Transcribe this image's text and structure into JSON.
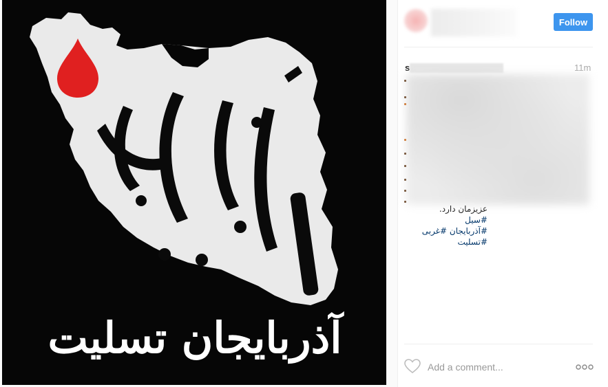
{
  "post": {
    "image": {
      "caption_art_text": "آذربایجان تسلیت",
      "map_label": "آذربایجان",
      "colors": {
        "background": "#060606",
        "map": "#eaeaea",
        "drop": "#e02020"
      }
    },
    "author": {
      "username_visible_initial": "s"
    },
    "follow_label": "Follow",
    "timestamp": "11m",
    "caption": {
      "last_line": "عزیزمان دارد.",
      "hashtags": [
        "#سیل",
        "#آذربایجان",
        "#غربی",
        "#تسلیت"
      ]
    },
    "comment": {
      "placeholder": "Add a comment..."
    }
  },
  "colors": {
    "accent": "#3d95ee",
    "hashtag": "#003569",
    "muted": "#a8a8a8"
  }
}
